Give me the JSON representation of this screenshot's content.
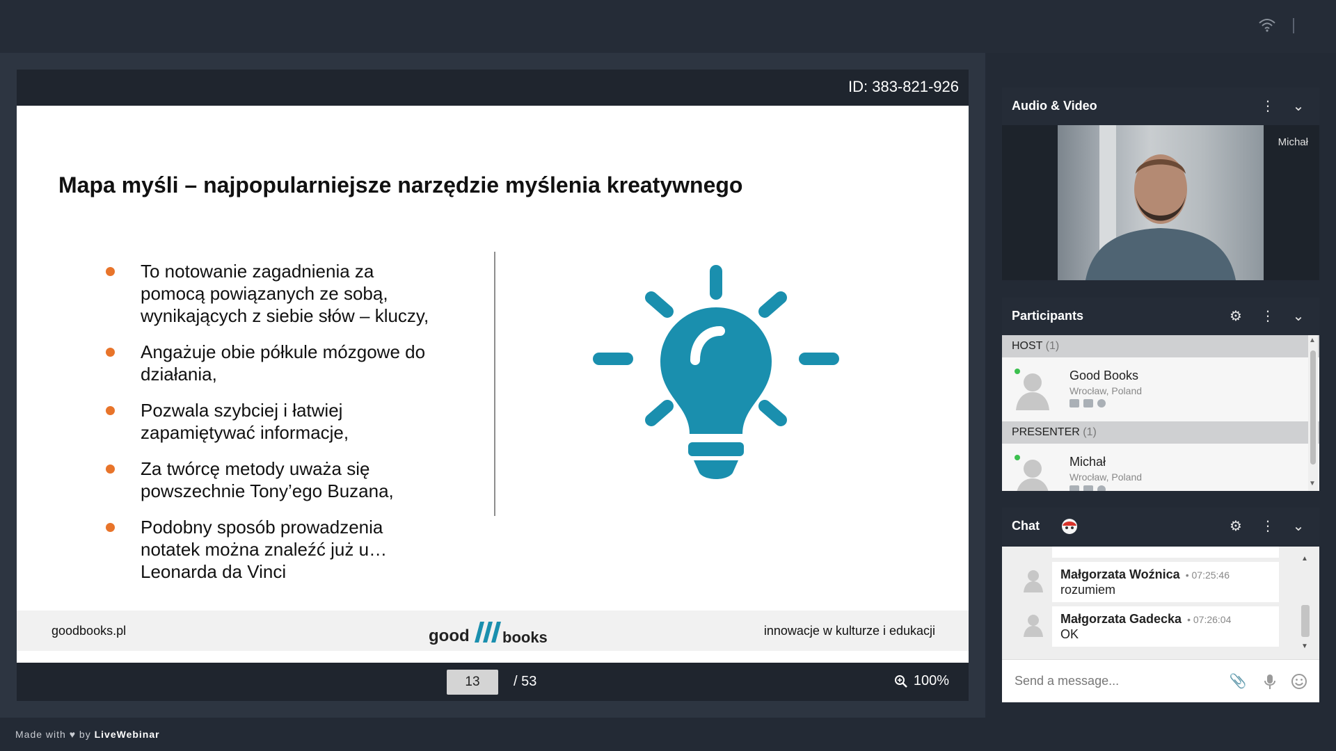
{
  "app": {
    "brand": "LiveWebinar",
    "made_with_prefix": "Made with",
    "made_with_by": "by",
    "accent_color": "#1a8fae",
    "bullet_color": "#e8742a"
  },
  "presentation": {
    "meeting_id": "ID: 383-821-926",
    "slide": {
      "title": "Mapa myśli – najpopularniejsze narzędzie myślenia kreatywnego",
      "bullets": [
        "To notowanie zagadnienia za pomocą powiązanych ze sobą, wynikających z siebie słów – kluczy,",
        "Angażuje obie półkule mózgowe do działania,",
        "Pozwala szybciej i łatwiej zapamiętywać informacje,",
        "Za twórcę metody uważa się powszechnie Tony’ego Buzana,",
        "Podobny sposób prowadzenia notatek można znaleźć już u…Leonarda da Vinci"
      ],
      "illustration": "lightbulb-icon",
      "footer": {
        "left": "goodbooks.pl",
        "logo_left": "good",
        "logo_right": "books",
        "right": "innowacje w kulturze i edukacji"
      }
    },
    "pager": {
      "current_page": "13",
      "total": "/ 53",
      "zoom": "100%"
    }
  },
  "sidebar": {
    "audio_video": {
      "title": "Audio & Video",
      "video_name": "Michał"
    },
    "participants": {
      "title": "Participants",
      "groups": [
        {
          "label": "HOST",
          "count": "(1)",
          "people": [
            {
              "name": "Good Books",
              "location": "Wrocław, Poland"
            }
          ]
        },
        {
          "label": "PRESENTER",
          "count": "(1)",
          "people": [
            {
              "name": "Michał",
              "location": "Wrocław, Poland"
            }
          ]
        }
      ]
    },
    "chat": {
      "title": "Chat",
      "messages": [
        {
          "from": "Małgorzata Woźnica",
          "time": "• 07:25:46",
          "text": "rozumiem"
        },
        {
          "from": "Małgorzata Gadecka",
          "time": "• 07:26:04",
          "text": "OK"
        }
      ],
      "input_placeholder": "Send a message..."
    }
  }
}
